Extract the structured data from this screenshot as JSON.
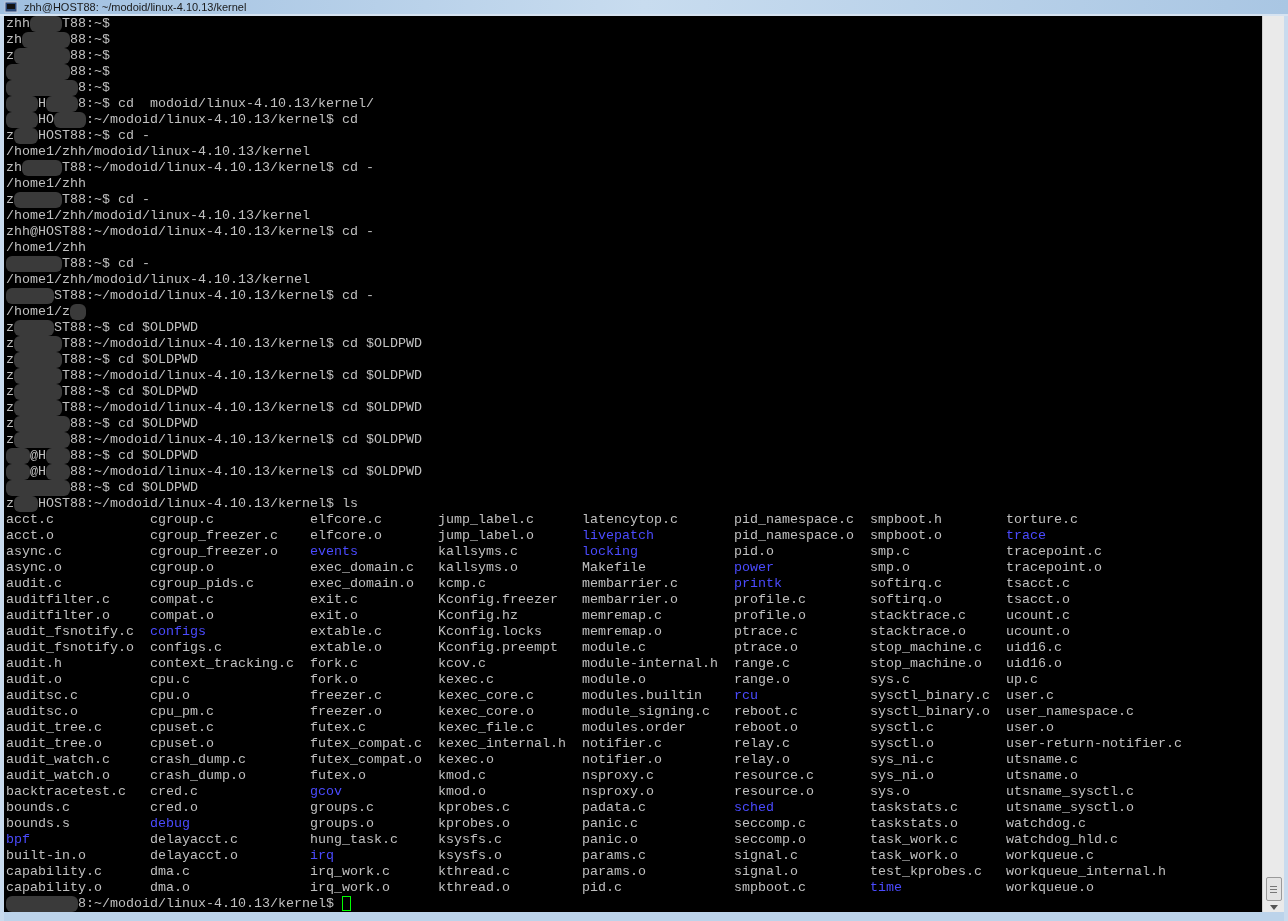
{
  "window": {
    "title": "zhh@HOST88: ~/modoid/linux-4.10.13/kernel"
  },
  "lines": [
    "zhh    T88:~$",
    "zh      88:~$",
    "z       88:~$",
    "        88:~$",
    "         8:~$",
    "    H    8:~$ cd  modoid/linux-4.10.13/kernel/",
    "    HO    :~/modoid/linux-4.10.13/kernel$ cd",
    "z   HOST88:~$ cd -",
    "/home1/zhh/modoid/linux-4.10.13/kernel",
    "zh     T88:~/modoid/linux-4.10.13/kernel$ cd -",
    "/home1/zhh",
    "z      T88:~$ cd -",
    "/home1/zhh/modoid/linux-4.10.13/kernel",
    "zhh@HOST88:~/modoid/linux-4.10.13/kernel$ cd -",
    "/home1/zhh",
    "       T88:~$ cd -",
    "/home1/zhh/modoid/linux-4.10.13/kernel",
    "      ST88:~/modoid/linux-4.10.13/kernel$ cd -",
    "/home1/z  ",
    "z     ST88:~$ cd $OLDPWD",
    "z      T88:~/modoid/linux-4.10.13/kernel$ cd $OLDPWD",
    "z      T88:~$ cd $OLDPWD",
    "z      T88:~/modoid/linux-4.10.13/kernel$ cd $OLDPWD",
    "z      T88:~$ cd $OLDPWD",
    "z      T88:~/modoid/linux-4.10.13/kernel$ cd $OLDPWD",
    "z       88:~$ cd $OLDPWD",
    "z       88:~/modoid/linux-4.10.13/kernel$ cd $OLDPWD",
    "   @H   88:~$ cd $OLDPWD",
    "   @H   88:~/modoid/linux-4.10.13/kernel$ cd $OLDPWD",
    "        88:~$ cd $OLDPWD",
    "z   HOST88:~/modoid/linux-4.10.13/kernel$ ls"
  ],
  "ls_output": {
    "columns": [
      [
        {
          "name": "acct.c",
          "directory": false
        },
        {
          "name": "acct.o",
          "directory": false
        },
        {
          "name": "async.c",
          "directory": false
        },
        {
          "name": "async.o",
          "directory": false
        },
        {
          "name": "audit.c",
          "directory": false
        },
        {
          "name": "auditfilter.c",
          "directory": false
        },
        {
          "name": "auditfilter.o",
          "directory": false
        },
        {
          "name": "audit_fsnotify.c",
          "directory": false
        },
        {
          "name": "audit_fsnotify.o",
          "directory": false
        },
        {
          "name": "audit.h",
          "directory": false
        },
        {
          "name": "audit.o",
          "directory": false
        },
        {
          "name": "auditsc.c",
          "directory": false
        },
        {
          "name": "auditsc.o",
          "directory": false
        },
        {
          "name": "audit_tree.c",
          "directory": false
        },
        {
          "name": "audit_tree.o",
          "directory": false
        },
        {
          "name": "audit_watch.c",
          "directory": false
        },
        {
          "name": "audit_watch.o",
          "directory": false
        },
        {
          "name": "backtracetest.c",
          "directory": false
        },
        {
          "name": "bounds.c",
          "directory": false
        },
        {
          "name": "bounds.s",
          "directory": false
        },
        {
          "name": "bpf",
          "directory": true
        },
        {
          "name": "built-in.o",
          "directory": false
        },
        {
          "name": "capability.c",
          "directory": false
        },
        {
          "name": "capability.o",
          "directory": false
        }
      ],
      [
        {
          "name": "cgroup.c",
          "directory": false
        },
        {
          "name": "cgroup_freezer.c",
          "directory": false
        },
        {
          "name": "cgroup_freezer.o",
          "directory": false
        },
        {
          "name": "cgroup.o",
          "directory": false
        },
        {
          "name": "cgroup_pids.c",
          "directory": false
        },
        {
          "name": "compat.c",
          "directory": false
        },
        {
          "name": "compat.o",
          "directory": false
        },
        {
          "name": "configs",
          "directory": true
        },
        {
          "name": "configs.c",
          "directory": false
        },
        {
          "name": "context_tracking.c",
          "directory": false
        },
        {
          "name": "cpu.c",
          "directory": false
        },
        {
          "name": "cpu.o",
          "directory": false
        },
        {
          "name": "cpu_pm.c",
          "directory": false
        },
        {
          "name": "cpuset.c",
          "directory": false
        },
        {
          "name": "cpuset.o",
          "directory": false
        },
        {
          "name": "crash_dump.c",
          "directory": false
        },
        {
          "name": "crash_dump.o",
          "directory": false
        },
        {
          "name": "cred.c",
          "directory": false
        },
        {
          "name": "cred.o",
          "directory": false
        },
        {
          "name": "debug",
          "directory": true
        },
        {
          "name": "delayacct.c",
          "directory": false
        },
        {
          "name": "delayacct.o",
          "directory": false
        },
        {
          "name": "dma.c",
          "directory": false
        },
        {
          "name": "dma.o",
          "directory": false
        }
      ],
      [
        {
          "name": "elfcore.c",
          "directory": false
        },
        {
          "name": "elfcore.o",
          "directory": false
        },
        {
          "name": "events",
          "directory": true
        },
        {
          "name": "exec_domain.c",
          "directory": false
        },
        {
          "name": "exec_domain.o",
          "directory": false
        },
        {
          "name": "exit.c",
          "directory": false
        },
        {
          "name": "exit.o",
          "directory": false
        },
        {
          "name": "extable.c",
          "directory": false
        },
        {
          "name": "extable.o",
          "directory": false
        },
        {
          "name": "fork.c",
          "directory": false
        },
        {
          "name": "fork.o",
          "directory": false
        },
        {
          "name": "freezer.c",
          "directory": false
        },
        {
          "name": "freezer.o",
          "directory": false
        },
        {
          "name": "futex.c",
          "directory": false
        },
        {
          "name": "futex_compat.c",
          "directory": false
        },
        {
          "name": "futex_compat.o",
          "directory": false
        },
        {
          "name": "futex.o",
          "directory": false
        },
        {
          "name": "gcov",
          "directory": true
        },
        {
          "name": "groups.c",
          "directory": false
        },
        {
          "name": "groups.o",
          "directory": false
        },
        {
          "name": "hung_task.c",
          "directory": false
        },
        {
          "name": "irq",
          "directory": true
        },
        {
          "name": "irq_work.c",
          "directory": false
        },
        {
          "name": "irq_work.o",
          "directory": false
        }
      ],
      [
        {
          "name": "jump_label.c",
          "directory": false
        },
        {
          "name": "jump_label.o",
          "directory": false
        },
        {
          "name": "kallsyms.c",
          "directory": false
        },
        {
          "name": "kallsyms.o",
          "directory": false
        },
        {
          "name": "kcmp.c",
          "directory": false
        },
        {
          "name": "Kconfig.freezer",
          "directory": false
        },
        {
          "name": "Kconfig.hz",
          "directory": false
        },
        {
          "name": "Kconfig.locks",
          "directory": false
        },
        {
          "name": "Kconfig.preempt",
          "directory": false
        },
        {
          "name": "kcov.c",
          "directory": false
        },
        {
          "name": "kexec.c",
          "directory": false
        },
        {
          "name": "kexec_core.c",
          "directory": false
        },
        {
          "name": "kexec_core.o",
          "directory": false
        },
        {
          "name": "kexec_file.c",
          "directory": false
        },
        {
          "name": "kexec_internal.h",
          "directory": false
        },
        {
          "name": "kexec.o",
          "directory": false
        },
        {
          "name": "kmod.c",
          "directory": false
        },
        {
          "name": "kmod.o",
          "directory": false
        },
        {
          "name": "kprobes.c",
          "directory": false
        },
        {
          "name": "kprobes.o",
          "directory": false
        },
        {
          "name": "ksysfs.c",
          "directory": false
        },
        {
          "name": "ksysfs.o",
          "directory": false
        },
        {
          "name": "kthread.c",
          "directory": false
        },
        {
          "name": "kthread.o",
          "directory": false
        }
      ],
      [
        {
          "name": "latencytop.c",
          "directory": false
        },
        {
          "name": "livepatch",
          "directory": true
        },
        {
          "name": "locking",
          "directory": true
        },
        {
          "name": "Makefile",
          "directory": false
        },
        {
          "name": "membarrier.c",
          "directory": false
        },
        {
          "name": "membarrier.o",
          "directory": false
        },
        {
          "name": "memremap.c",
          "directory": false
        },
        {
          "name": "memremap.o",
          "directory": false
        },
        {
          "name": "module.c",
          "directory": false
        },
        {
          "name": "module-internal.h",
          "directory": false
        },
        {
          "name": "module.o",
          "directory": false
        },
        {
          "name": "modules.builtin",
          "directory": false
        },
        {
          "name": "module_signing.c",
          "directory": false
        },
        {
          "name": "modules.order",
          "directory": false
        },
        {
          "name": "notifier.c",
          "directory": false
        },
        {
          "name": "notifier.o",
          "directory": false
        },
        {
          "name": "nsproxy.c",
          "directory": false
        },
        {
          "name": "nsproxy.o",
          "directory": false
        },
        {
          "name": "padata.c",
          "directory": false
        },
        {
          "name": "panic.c",
          "directory": false
        },
        {
          "name": "panic.o",
          "directory": false
        },
        {
          "name": "params.c",
          "directory": false
        },
        {
          "name": "params.o",
          "directory": false
        },
        {
          "name": "pid.c",
          "directory": false
        }
      ],
      [
        {
          "name": "pid_namespace.c",
          "directory": false
        },
        {
          "name": "pid_namespace.o",
          "directory": false
        },
        {
          "name": "pid.o",
          "directory": false
        },
        {
          "name": "power",
          "directory": true
        },
        {
          "name": "printk",
          "directory": true
        },
        {
          "name": "profile.c",
          "directory": false
        },
        {
          "name": "profile.o",
          "directory": false
        },
        {
          "name": "ptrace.c",
          "directory": false
        },
        {
          "name": "ptrace.o",
          "directory": false
        },
        {
          "name": "range.c",
          "directory": false
        },
        {
          "name": "range.o",
          "directory": false
        },
        {
          "name": "rcu",
          "directory": true
        },
        {
          "name": "reboot.c",
          "directory": false
        },
        {
          "name": "reboot.o",
          "directory": false
        },
        {
          "name": "relay.c",
          "directory": false
        },
        {
          "name": "relay.o",
          "directory": false
        },
        {
          "name": "resource.c",
          "directory": false
        },
        {
          "name": "resource.o",
          "directory": false
        },
        {
          "name": "sched",
          "directory": true
        },
        {
          "name": "seccomp.c",
          "directory": false
        },
        {
          "name": "seccomp.o",
          "directory": false
        },
        {
          "name": "signal.c",
          "directory": false
        },
        {
          "name": "signal.o",
          "directory": false
        },
        {
          "name": "smpboot.c",
          "directory": false
        }
      ],
      [
        {
          "name": "smpboot.h",
          "directory": false
        },
        {
          "name": "smpboot.o",
          "directory": false
        },
        {
          "name": "smp.c",
          "directory": false
        },
        {
          "name": "smp.o",
          "directory": false
        },
        {
          "name": "softirq.c",
          "directory": false
        },
        {
          "name": "softirq.o",
          "directory": false
        },
        {
          "name": "stacktrace.c",
          "directory": false
        },
        {
          "name": "stacktrace.o",
          "directory": false
        },
        {
          "name": "stop_machine.c",
          "directory": false
        },
        {
          "name": "stop_machine.o",
          "directory": false
        },
        {
          "name": "sys.c",
          "directory": false
        },
        {
          "name": "sysctl_binary.c",
          "directory": false
        },
        {
          "name": "sysctl_binary.o",
          "directory": false
        },
        {
          "name": "sysctl.c",
          "directory": false
        },
        {
          "name": "sysctl.o",
          "directory": false
        },
        {
          "name": "sys_ni.c",
          "directory": false
        },
        {
          "name": "sys_ni.o",
          "directory": false
        },
        {
          "name": "sys.o",
          "directory": false
        },
        {
          "name": "taskstats.c",
          "directory": false
        },
        {
          "name": "taskstats.o",
          "directory": false
        },
        {
          "name": "task_work.c",
          "directory": false
        },
        {
          "name": "task_work.o",
          "directory": false
        },
        {
          "name": "test_kprobes.c",
          "directory": false
        },
        {
          "name": "time",
          "directory": true
        }
      ],
      [
        {
          "name": "torture.c",
          "directory": false
        },
        {
          "name": "trace",
          "directory": true
        },
        {
          "name": "tracepoint.c",
          "directory": false
        },
        {
          "name": "tracepoint.o",
          "directory": false
        },
        {
          "name": "tsacct.c",
          "directory": false
        },
        {
          "name": "tsacct.o",
          "directory": false
        },
        {
          "name": "ucount.c",
          "directory": false
        },
        {
          "name": "ucount.o",
          "directory": false
        },
        {
          "name": "uid16.c",
          "directory": false
        },
        {
          "name": "uid16.o",
          "directory": false
        },
        {
          "name": "up.c",
          "directory": false
        },
        {
          "name": "user.c",
          "directory": false
        },
        {
          "name": "user_namespace.c",
          "directory": false
        },
        {
          "name": "user.o",
          "directory": false
        },
        {
          "name": "user-return-notifier.c",
          "directory": false
        },
        {
          "name": "utsname.c",
          "directory": false
        },
        {
          "name": "utsname.o",
          "directory": false
        },
        {
          "name": "utsname_sysctl.c",
          "directory": false
        },
        {
          "name": "utsname_sysctl.o",
          "directory": false
        },
        {
          "name": "watchdog.c",
          "directory": false
        },
        {
          "name": "watchdog_hld.c",
          "directory": false
        },
        {
          "name": "workqueue.c",
          "directory": false
        },
        {
          "name": "workqueue_internal.h",
          "directory": false
        },
        {
          "name": "workqueue.o",
          "directory": false
        }
      ]
    ]
  },
  "prompt": {
    "text": "         8:~/modoid/linux-4.10.13/kernel$",
    "cursor": true
  }
}
